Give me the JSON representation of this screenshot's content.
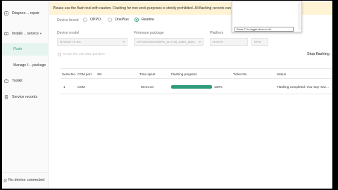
{
  "banner": {
    "text": "Please use the flash tool with caution. Flashing for non work purposes is strictly prohibited. All flashing records can"
  },
  "popup": {
    "input_value": "Press F1 to toggle show on off"
  },
  "sidebar": {
    "items": [
      {
        "label": "Diagnos… repair",
        "icon": "diagnose-icon"
      },
      {
        "label": "Installi… service",
        "icon": "install-icon"
      },
      {
        "label": "Flash",
        "icon": ""
      },
      {
        "label": "Manage f… package",
        "icon": ""
      },
      {
        "label": "Toolkit",
        "icon": "toolkit-icon"
      },
      {
        "label": "Service records",
        "icon": "records-icon"
      }
    ],
    "status": "No device connected"
  },
  "form": {
    "device_brand_label": "Device brand",
    "brands": [
      "OPPO",
      "OnePlus",
      "Realme"
    ],
    "selected_brand": "Realme",
    "device_model_label": "Device model",
    "device_model_value": "NARZO 70 5G",
    "firmware_label": "Firmware package",
    "firmware_value": "CPH2617EEX00P8_11.F.16_0160_2024",
    "platform_label": "Platform",
    "platform_value": "MT6"
  },
  "checkbox_label": "Erase the usb data partition",
  "stop_label": "Stop flashing",
  "table": {
    "headers": [
      "Serial No.",
      "COM port",
      "SN",
      "Time spent",
      "Flashing progress",
      "Ticket No.",
      "Status"
    ],
    "rows": [
      {
        "serial": "1",
        "com": "COM",
        "sn": "",
        "time": "00:01:10",
        "progress": 100,
        "progress_text": "100%",
        "ticket": "",
        "status": "Flashing completed. You may now…"
      }
    ]
  },
  "colors": {
    "accent": "#2e9c7b",
    "banner_bg": "#fff3d6"
  }
}
